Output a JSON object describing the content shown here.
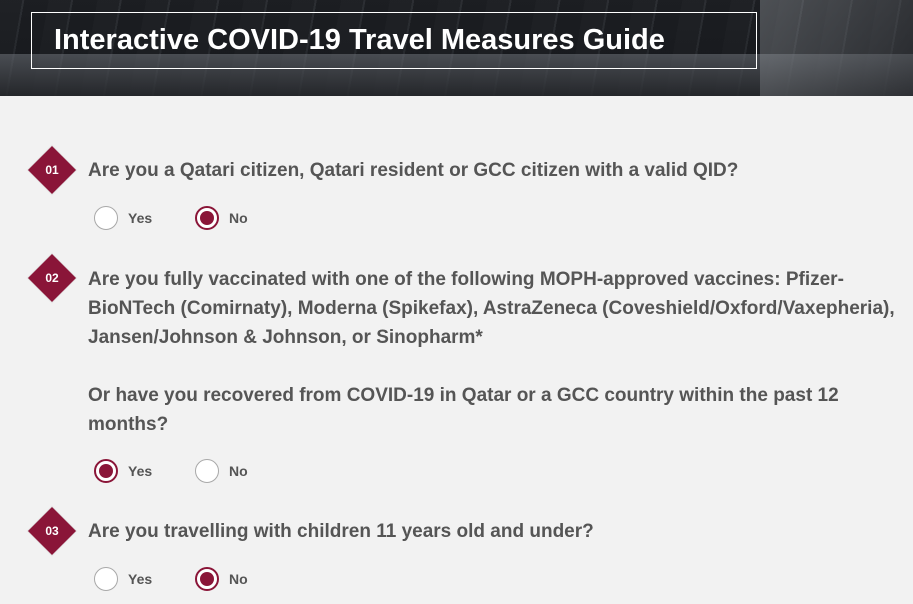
{
  "header": {
    "title": "Interactive COVID-19 Travel Measures Guide"
  },
  "colors": {
    "accent": "#8a1538",
    "text": "#555555",
    "background": "#f2f2f2"
  },
  "questions": [
    {
      "number": "01",
      "text": "Are you a Qatari citizen, Qatari resident or GCC citizen with a valid QID?",
      "options": [
        {
          "label": "Yes",
          "selected": false
        },
        {
          "label": "No",
          "selected": true
        }
      ]
    },
    {
      "number": "02",
      "text_line1": "Are you fully vaccinated with one of the following MOPH-approved vaccines: Pfizer-BioNTech (Comirnaty), Moderna (Spikefax), AstraZeneca (Coveshield/Oxford/Vaxepheria), Jansen/Johnson & Johnson, or Sinopharm*",
      "text_line2": "Or have you recovered from COVID-19 in Qatar or a GCC country within the past 12 months?",
      "options": [
        {
          "label": "Yes",
          "selected": true
        },
        {
          "label": "No",
          "selected": false
        }
      ]
    },
    {
      "number": "03",
      "text": "Are you travelling with children 11 years old and under?",
      "options": [
        {
          "label": "Yes",
          "selected": false
        },
        {
          "label": "No",
          "selected": true
        }
      ]
    }
  ]
}
